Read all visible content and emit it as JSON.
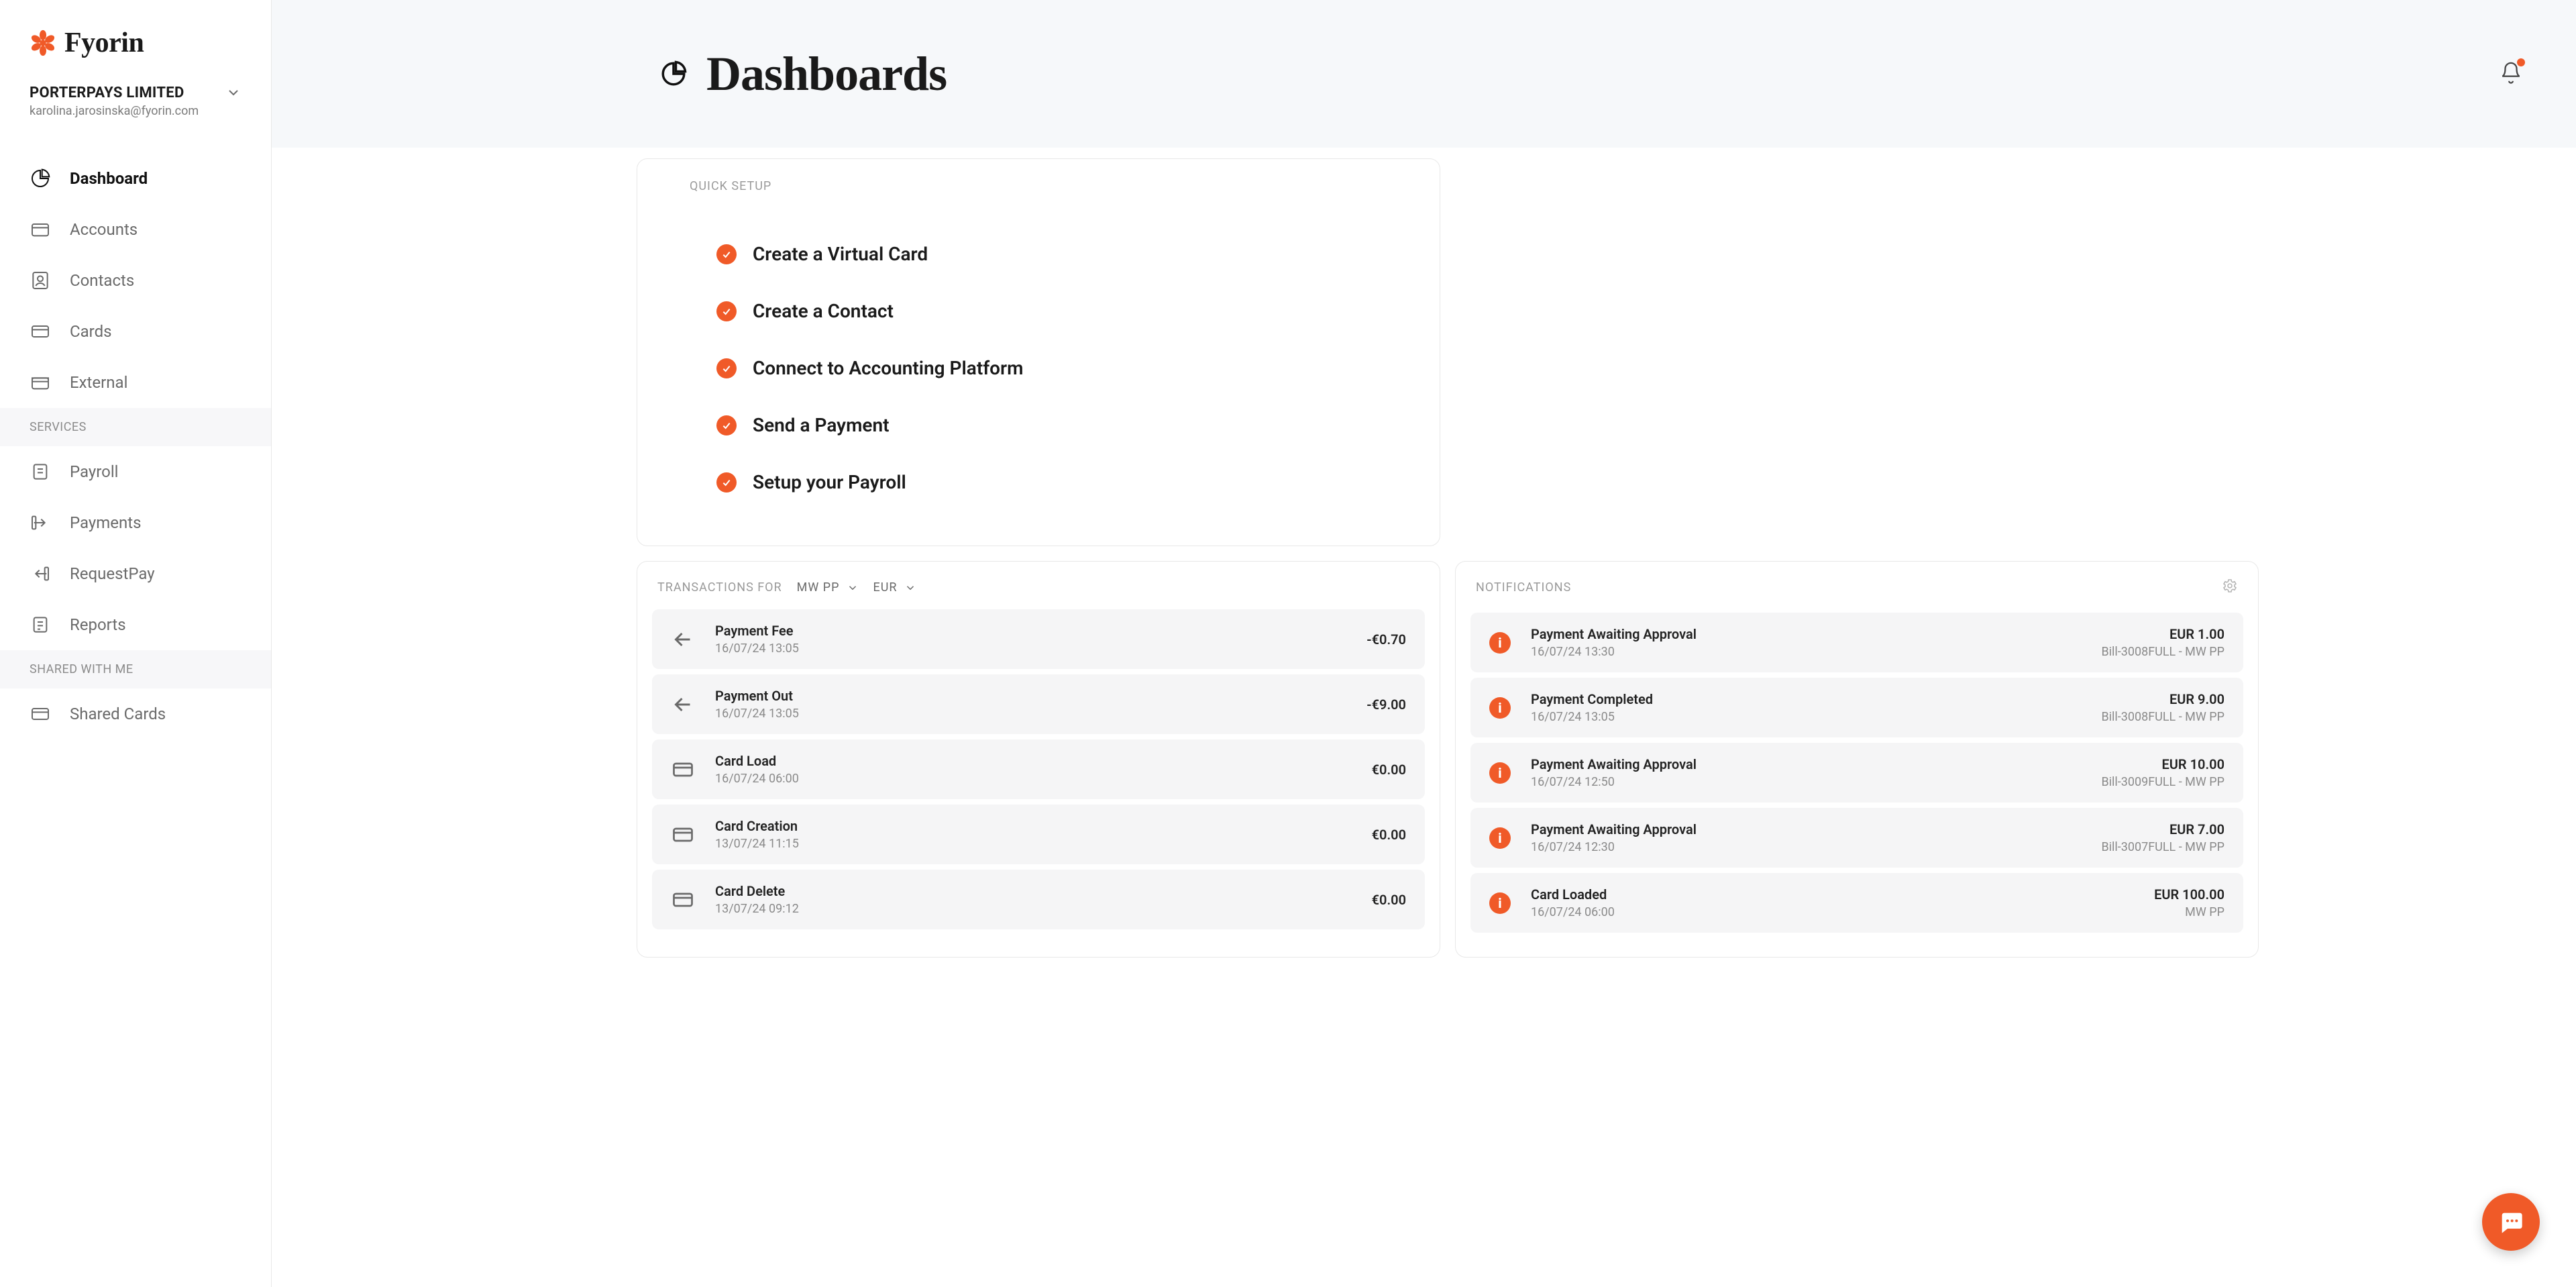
{
  "brand": {
    "name": "Fyorin"
  },
  "org": {
    "name": "PORTERPAYS LIMITED",
    "email": "karolina.jarosinska@fyorin.com"
  },
  "sidebar": {
    "primary": [
      {
        "label": "Dashboard"
      },
      {
        "label": "Accounts"
      },
      {
        "label": "Contacts"
      },
      {
        "label": "Cards"
      },
      {
        "label": "External"
      }
    ],
    "services_header": "SERVICES",
    "services": [
      {
        "label": "Payroll"
      },
      {
        "label": "Payments"
      },
      {
        "label": "RequestPay"
      },
      {
        "label": "Reports"
      }
    ],
    "shared_header": "SHARED WITH ME",
    "shared": [
      {
        "label": "Shared Cards"
      }
    ]
  },
  "page": {
    "title": "Dashboards"
  },
  "quick_setup": {
    "label": "QUICK SETUP",
    "items": [
      {
        "label": "Create a Virtual Card"
      },
      {
        "label": "Create a Contact"
      },
      {
        "label": "Connect to Accounting Platform"
      },
      {
        "label": "Send a Payment"
      },
      {
        "label": "Setup your Payroll"
      }
    ]
  },
  "transactions": {
    "label": "TRANSACTIONS FOR",
    "account": "MW PP",
    "currency": "EUR",
    "items": [
      {
        "icon": "arrow-left",
        "title": "Payment Fee",
        "date": "16/07/24 13:05",
        "amount": "-€0.70"
      },
      {
        "icon": "arrow-left",
        "title": "Payment Out",
        "date": "16/07/24 13:05",
        "amount": "-€9.00"
      },
      {
        "icon": "card",
        "title": "Card Load",
        "date": "16/07/24 06:00",
        "amount": "€0.00"
      },
      {
        "icon": "card",
        "title": "Card Creation",
        "date": "13/07/24 11:15",
        "amount": "€0.00"
      },
      {
        "icon": "card",
        "title": "Card Delete",
        "date": "13/07/24 09:12",
        "amount": "€0.00"
      }
    ]
  },
  "notifications": {
    "label": "NOTIFICATIONS",
    "items": [
      {
        "title": "Payment Awaiting Approval",
        "date": "16/07/24 13:30",
        "amount": "EUR 1.00",
        "ref": "Bill-3008FULL - MW PP"
      },
      {
        "title": "Payment Completed",
        "date": "16/07/24 13:05",
        "amount": "EUR 9.00",
        "ref": "Bill-3008FULL - MW PP"
      },
      {
        "title": "Payment Awaiting Approval",
        "date": "16/07/24 12:50",
        "amount": "EUR 10.00",
        "ref": "Bill-3009FULL - MW PP"
      },
      {
        "title": "Payment Awaiting Approval",
        "date": "16/07/24 12:30",
        "amount": "EUR 7.00",
        "ref": "Bill-3007FULL - MW PP"
      },
      {
        "title": "Card Loaded",
        "date": "16/07/24 06:00",
        "amount": "EUR 100.00",
        "ref": "MW PP"
      }
    ]
  }
}
